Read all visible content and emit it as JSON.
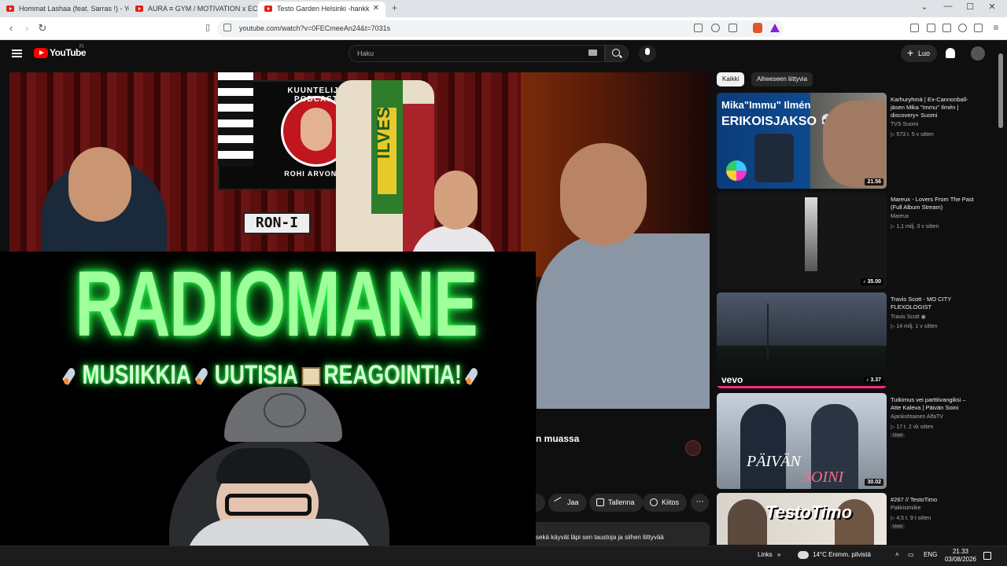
{
  "browser": {
    "tabs": [
      {
        "title": "Hommat Lashaa (feat. Sarras !) - Yo"
      },
      {
        "title": "AURA ≡ GYM / MOTIVATION x EC"
      },
      {
        "title": "Testo Garden Helsinki -hankk"
      }
    ],
    "url": "youtube.com/watch?v=0FECmeeAn24&t=7031s",
    "window_controls": {
      "minimize": "—",
      "maximize": "☐",
      "close": "✕"
    }
  },
  "youtube": {
    "logo_text": "YouTube",
    "country": "FI",
    "search_placeholder": "Haku",
    "create_label": "Luo"
  },
  "video": {
    "podcast_label_top": "KUUNTELIJA PODCAST",
    "podcast_label_bottom": "ROHI ARVONEN",
    "scarf_text": "ILVES",
    "plate_text": "RON-I",
    "overlay_title": "RADIOMANE",
    "overlay_items": [
      "MUSIIKKIA",
      "UUTISIA",
      "REAGOINTIA!"
    ],
    "title_partial": "n muassa",
    "actions": {
      "share": "Jaa",
      "save": "Tallenna",
      "thanks": "Kiitos",
      "more": "⋯"
    },
    "description_partial": "sekä käyvät läpi sen taustoja ja siihen liittyvää"
  },
  "sidebar": {
    "chips": [
      "Kaikki",
      "Aiheeseen liittyvia"
    ],
    "recommendations": [
      {
        "title": "Karhuryhmä | Ex-Cannonball-jäsen Mika \"Immu\" Ilmén | discovery+ Suomi",
        "channel": "TVS Suomi",
        "meta": "▷ 573 t.  5 v sitten",
        "duration": "21.56",
        "thumb_text_1": "Mika\"Immu\" Ilmén",
        "thumb_text_2": "ERIKOISJAKSO 💀"
      },
      {
        "title": "Mareux - Lovers From The Past (Full Album Stream)",
        "channel": "Mareux",
        "meta": "▷ 1,1 milj.  3 v sitten",
        "duration": "♪ 35.00"
      },
      {
        "title": "Travis Scott - MO CITY FLEXOLOGIST",
        "channel": "Travis Scott ◉",
        "meta": "▷ 14 milj.  1 v sitten",
        "duration": "♪ 3.37",
        "thumb_text_1": "vevo"
      },
      {
        "title": "Tutkimus vei parttiivangiksi – Atte Kaleva | Päivän Soini",
        "channel": "Ajankohtainen AlfaTV",
        "meta": "▷ 17 t.  2 vk sitten",
        "badge": "Uusi",
        "duration": "30.02",
        "thumb_text_1": "PÄIVÄN",
        "thumb_text_2": "SOINI"
      },
      {
        "title": "#267 // TestoTimo",
        "channel": "Pakkisimiike",
        "meta": "▷ 4,5 t.  9 t sitten",
        "badge": "Uusi",
        "thumb_text_1": "TestoTimo"
      }
    ]
  },
  "taskbar": {
    "links": "Links",
    "weather": "14°C  Enimm. pilvistä",
    "lang": "ENG",
    "time": "21.33",
    "date": "03/08/2026"
  },
  "colors": {
    "youtube_red": "#ff0000",
    "neon_green": "#9fff9a",
    "dark_bg": "#0f0f0f"
  }
}
